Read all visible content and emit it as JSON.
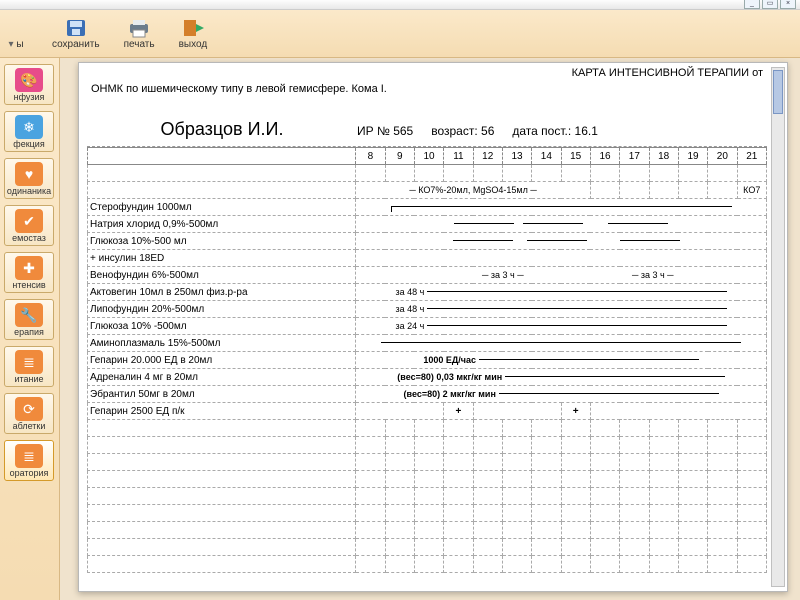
{
  "window": {
    "min": "_",
    "max": "▭",
    "close": "×"
  },
  "toolbar": {
    "items": [
      {
        "label": "ы"
      },
      {
        "label": "сохранить"
      },
      {
        "label": "печать"
      },
      {
        "label": "выход"
      }
    ]
  },
  "sidebar": {
    "items": [
      {
        "label": "нфузия",
        "color": "#e74c8a",
        "glyph": "🎨"
      },
      {
        "label": "фекция",
        "color": "#4aa3e0",
        "glyph": "❄"
      },
      {
        "label": "одинаника",
        "color": "#f08a3c",
        "glyph": "♥"
      },
      {
        "label": "емостаз",
        "color": "#f08a3c",
        "glyph": "✔"
      },
      {
        "label": "нтенсив",
        "color": "#f08a3c",
        "glyph": "✚"
      },
      {
        "label": "ерапия",
        "color": "#f08a3c",
        "glyph": "🔧"
      },
      {
        "label": "итание",
        "color": "#f08a3c",
        "glyph": "≣"
      },
      {
        "label": "аблетки",
        "color": "#f08a3c",
        "glyph": "⟳"
      },
      {
        "label": "оратория",
        "color": "#f08a3c",
        "glyph": "≣",
        "active": true
      }
    ]
  },
  "doc": {
    "title": "КАРТА ИНТЕНСИВНОЙ ТЕРАПИИ от",
    "diagnosis": "ОНМК по ишемическому типу в левой гемисфере. Кома I.",
    "patient": "Образцов И.И.",
    "ir_label": "ИР №",
    "ir_value": "565",
    "age_label": "возраст:",
    "age_value": "56",
    "date_label": "дата пост.:",
    "date_value": "16.1",
    "hours": [
      "8",
      "9",
      "10",
      "11",
      "12",
      "13",
      "14",
      "15",
      "16",
      "17",
      "18",
      "19",
      "20",
      "21"
    ],
    "note_top": "КО7%-20мл, MgSO4-15мл",
    "note_top_r": "КО7",
    "rows": [
      {
        "name": "Стерофундин 1000мл",
        "mark": "bar-long"
      },
      {
        "name": "Натрия хлорид 0,9%-500мл",
        "mark": "bar-seg"
      },
      {
        "name": "Глюкоза 10%-500 мл",
        "mark": "bar-seg2"
      },
      {
        "name": "  + инсулин 18ED",
        "mark": ""
      },
      {
        "name": "Венофундин 6%-500мл",
        "mark": "za3"
      },
      {
        "name": "Актовегин 10мл в 250мл физ.р-ра",
        "mark": "za48"
      },
      {
        "name": "Липофундин 20%-500мл",
        "mark": "za48b"
      },
      {
        "name": "Глюкоза 10% -500мл",
        "mark": "za24"
      },
      {
        "name": "Аминоплазмаль 15%-500мл",
        "mark": "line"
      },
      {
        "name": "Гепарин 20.000 ЕД в 20мл",
        "mark": "t1",
        "txt": "1000 ЕД/час"
      },
      {
        "name": "Адреналин 4 мг в 20мл",
        "mark": "t2",
        "txt": "(вес=80)  0,03 мкг/кг мин"
      },
      {
        "name": "Эбрантил 50мг в 20мл",
        "mark": "t3",
        "txt": "(вес=80)  2 мкг/кг мин"
      },
      {
        "name": "Гепарин 2500 ЕД  п/к",
        "mark": "plus"
      }
    ],
    "za3": "за 3 ч",
    "za48": "за 48 ч",
    "za24": "за 24 ч"
  }
}
